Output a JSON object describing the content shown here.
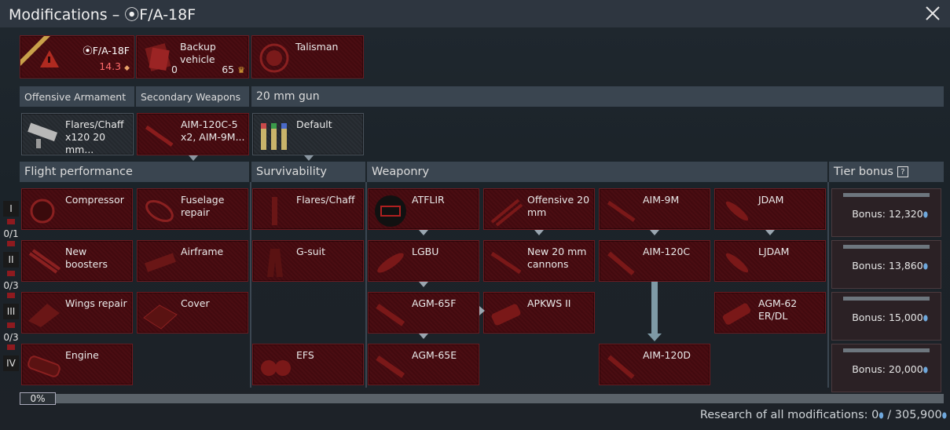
{
  "window": {
    "title": "Modifications – ⦿F/A-18F",
    "close_icon": "close-icon"
  },
  "vehicle": {
    "name": "⦿F/A-18F",
    "br": "14.3",
    "br_icon": "◆"
  },
  "backup": {
    "label": "Backup vehicle",
    "count": "0",
    "cost": "65"
  },
  "talisman": {
    "label": "Talisman"
  },
  "preset_headers": {
    "offensive": "Offensive Armament",
    "secondary": "Secondary Weapons",
    "gun": "20 mm gun"
  },
  "presets": {
    "offensive": "Flares/Chaff x120 20 mm...",
    "secondary": "AIM-120C-5 x2,  AIM-9M...",
    "gun": "Default"
  },
  "sections": {
    "flight": "Flight performance",
    "survivability": "Survivability",
    "weaponry": "Weaponry",
    "tier_bonus": "Tier bonus",
    "tier_help": "?"
  },
  "tiers": [
    {
      "roman": "I",
      "count": "0/1"
    },
    {
      "roman": "II",
      "count": "0/3"
    },
    {
      "roman": "III",
      "count": "0/3"
    },
    {
      "roman": "IV",
      "count": ""
    }
  ],
  "mods": {
    "compressor": "Compressor",
    "fuselage_repair": "Fuselage repair",
    "new_boosters": "New boosters",
    "airframe": "Airframe",
    "wings_repair": "Wings repair",
    "cover": "Cover",
    "engine": "Engine",
    "flares": "Flares/Chaff",
    "gsuit": "G-suit",
    "efs": "EFS",
    "atflir": "ATFLIR",
    "offensive20": "Offensive 20 mm",
    "aim9m": "AIM-9M",
    "jdam": "JDAM",
    "lgbu": "LGBU",
    "new20": "New 20 mm cannons",
    "aim120c": "AIM-120C",
    "ljdam": "LJDAM",
    "agm65f": "AGM-65F",
    "apkws": "APKWS II",
    "agm62": "AGM-62 ER/DL",
    "agm65e": "AGM-65E",
    "aim120d": "AIM-120D"
  },
  "bonuses": [
    {
      "text": "Bonus: 12,320"
    },
    {
      "text": "Bonus: 13,860"
    },
    {
      "text": "Bonus: 15,000"
    },
    {
      "text": "Bonus: 20,000"
    }
  ],
  "progress": {
    "label": "0%",
    "value": 0
  },
  "research": {
    "text": "Research of all modifications: 0",
    "total": " / 305,900"
  },
  "colors": {
    "accent_red": "#4a0d12",
    "header": "#3a4550",
    "gem": "#6fa8dc"
  }
}
